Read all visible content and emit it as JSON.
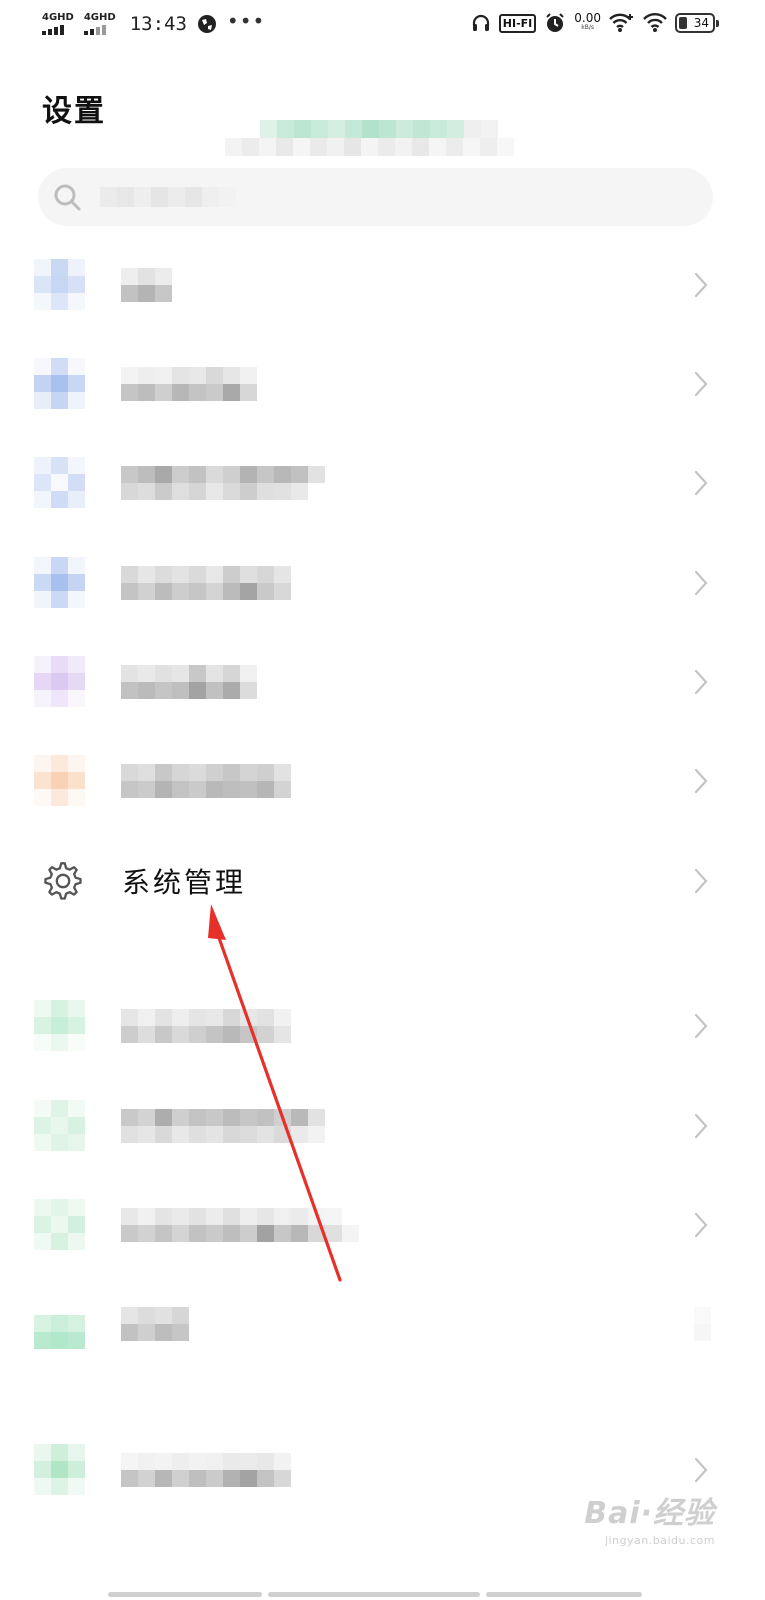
{
  "status_bar": {
    "signal1": "4GHD",
    "signal2": "4GHD",
    "time": "13:43",
    "more": "•••",
    "hifi": "HI-FI",
    "speed_value": "0.00",
    "speed_unit": "kB/s",
    "battery": "34"
  },
  "header": {
    "title": "设置"
  },
  "menu": {
    "system_management_label": "系统管理"
  },
  "watermark": {
    "brand": "Bai·经验",
    "url": "jingyan.baidu.com"
  },
  "colors": {
    "annotation_arrow": "#e8302a",
    "chevron": "#c4c4c4",
    "gear_icon": "#555555"
  }
}
